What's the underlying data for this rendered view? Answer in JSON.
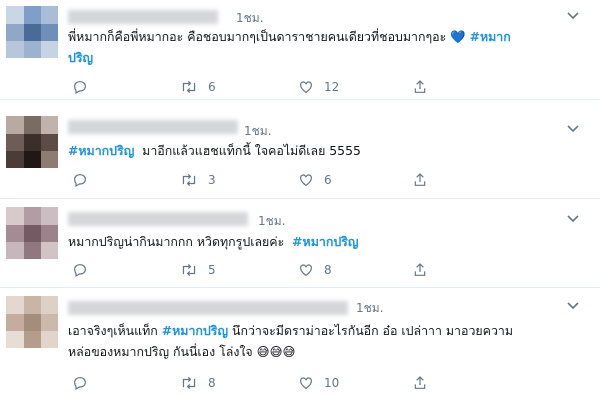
{
  "tweets": [
    {
      "time": "1ชม.",
      "text_before": "พี่หมากก็คือพี่หมากอะ คือชอบมากๆเป็นดาราชายคนเดียวที่ชอบมากๆอะ ",
      "emoji_heart": "💙",
      "hashtag": "#หมาก",
      "text_line2": "ปริญ",
      "replies": "",
      "retweets": "6",
      "likes": "12"
    },
    {
      "time": "1ชม.",
      "hashtag": "#หมากปริญ",
      "text_after": "มาอีกแล้วแฮชแท็กนี้ ใจคอไม่ดีเลย 5555",
      "replies": "",
      "retweets": "3",
      "likes": "6"
    },
    {
      "time": "1ชม.",
      "text_before": "หมากปริญน่ากินมากกก หวิดทุกรูปเลยค่ะ",
      "hashtag": "#หมากปริญ",
      "replies": "",
      "retweets": "5",
      "likes": "8"
    },
    {
      "time": "1ชม.",
      "text_before": "เอาจริงๆเห็นแท็ก",
      "hashtag": "#หมากปริญ",
      "text_after": "นึกว่าจะมีดราม่าอะไรกันอีก อ๋อ เปล่าาา มาอวยความ",
      "text_line2": "หล่อของหมากปริญ กันนี่เอง โล่งใจ",
      "emojis": "😅😅😅",
      "replies": "",
      "retweets": "8",
      "likes": "10"
    }
  ]
}
